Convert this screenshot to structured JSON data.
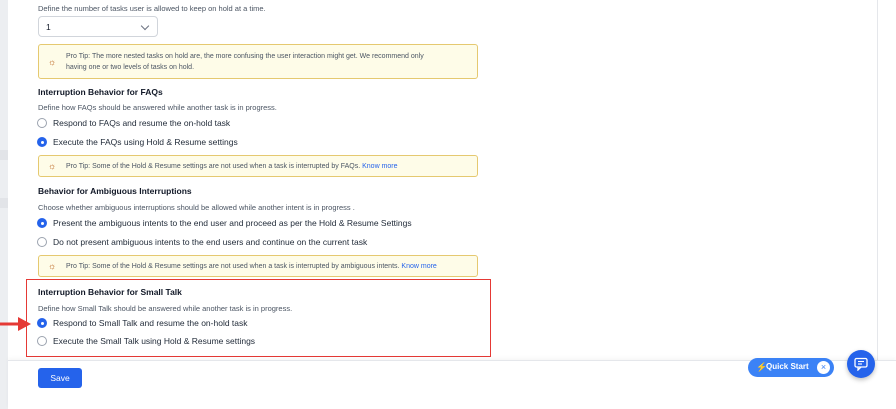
{
  "hold_limit": {
    "description": "Define the number of tasks user is allowed to keep on hold at a time.",
    "value": "1",
    "tip": [
      "Pro Tip: The more nested tasks on hold are, the more confusing the user interaction might get. We recommend only",
      "having one or two levels of tasks on hold."
    ]
  },
  "faqs": {
    "heading": "Interruption Behavior for FAQs",
    "description": "Define how FAQs should be answered while another task is in progress.",
    "options": [
      {
        "label": "Respond to FAQs and resume the on-hold task",
        "selected": false
      },
      {
        "label": "Execute the FAQs using Hold & Resume settings",
        "selected": true
      }
    ],
    "tip": "Pro Tip: Some of the Hold & Resume settings are not used when a task is interrupted by FAQs.",
    "tip_link": "Know more"
  },
  "ambiguous": {
    "heading": "Behavior for Ambiguous Interruptions",
    "description": "Choose whether ambiguous interruptions should be allowed while another intent is in progress .",
    "options": [
      {
        "label": "Present the ambiguous intents to the end user and proceed as per the Hold & Resume Settings",
        "selected": true
      },
      {
        "label": "Do not present ambiguous intents to the end users and continue on the current task",
        "selected": false
      }
    ],
    "tip": "Pro Tip: Some of the Hold & Resume settings are not used when a task is interrupted by ambiguous intents.",
    "tip_link": "Know more"
  },
  "small_talk": {
    "heading": "Interruption Behavior for Small Talk",
    "description": "Define how Small Talk should be answered while another task is in progress.",
    "options": [
      {
        "label": "Respond to Small Talk and resume the on-hold task",
        "selected": true
      },
      {
        "label": "Execute the Small Talk using Hold & Resume settings",
        "selected": false
      }
    ]
  },
  "footer": {
    "save_label": "Save",
    "quick_start_label": "Quick Start",
    "close_glyph": "×"
  },
  "icons": {
    "tip": "lightbulb-icon",
    "bolt": "bolt-icon",
    "chat": "chat-icon",
    "arrow": "arrow-right-icon"
  },
  "colors": {
    "accent": "#2563eb",
    "highlight": "#e53935",
    "tip_bg": "#fefce8",
    "tip_border": "#e5c970"
  }
}
